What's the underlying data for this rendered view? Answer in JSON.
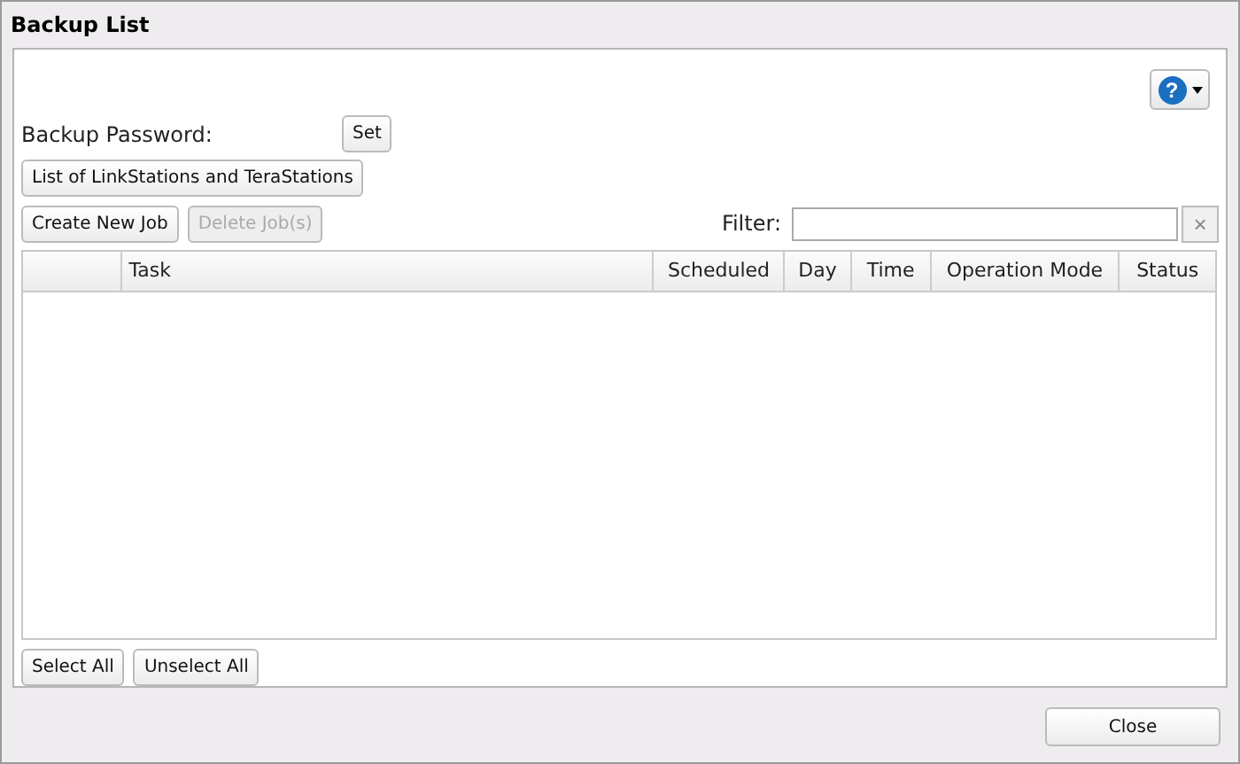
{
  "window": {
    "title": "Backup List"
  },
  "help_button": {
    "icon": "?"
  },
  "password": {
    "label": "Backup Password:",
    "button": "Set"
  },
  "stations_button": "List of LinkStations and TeraStations",
  "job_buttons": [
    {
      "label": "Create New Job",
      "disabled": false
    },
    {
      "label": "Delete Job(s)",
      "disabled": true
    }
  ],
  "filter": {
    "label": "Filter:",
    "clear": "×"
  },
  "table": {
    "columns": [
      "",
      "Task",
      "Scheduled",
      "Day",
      "Time",
      "Operation Mode",
      "Status"
    ]
  },
  "selection_buttons": [
    "Select All",
    "Unselect All"
  ],
  "footer_buttons": [
    "Close"
  ]
}
